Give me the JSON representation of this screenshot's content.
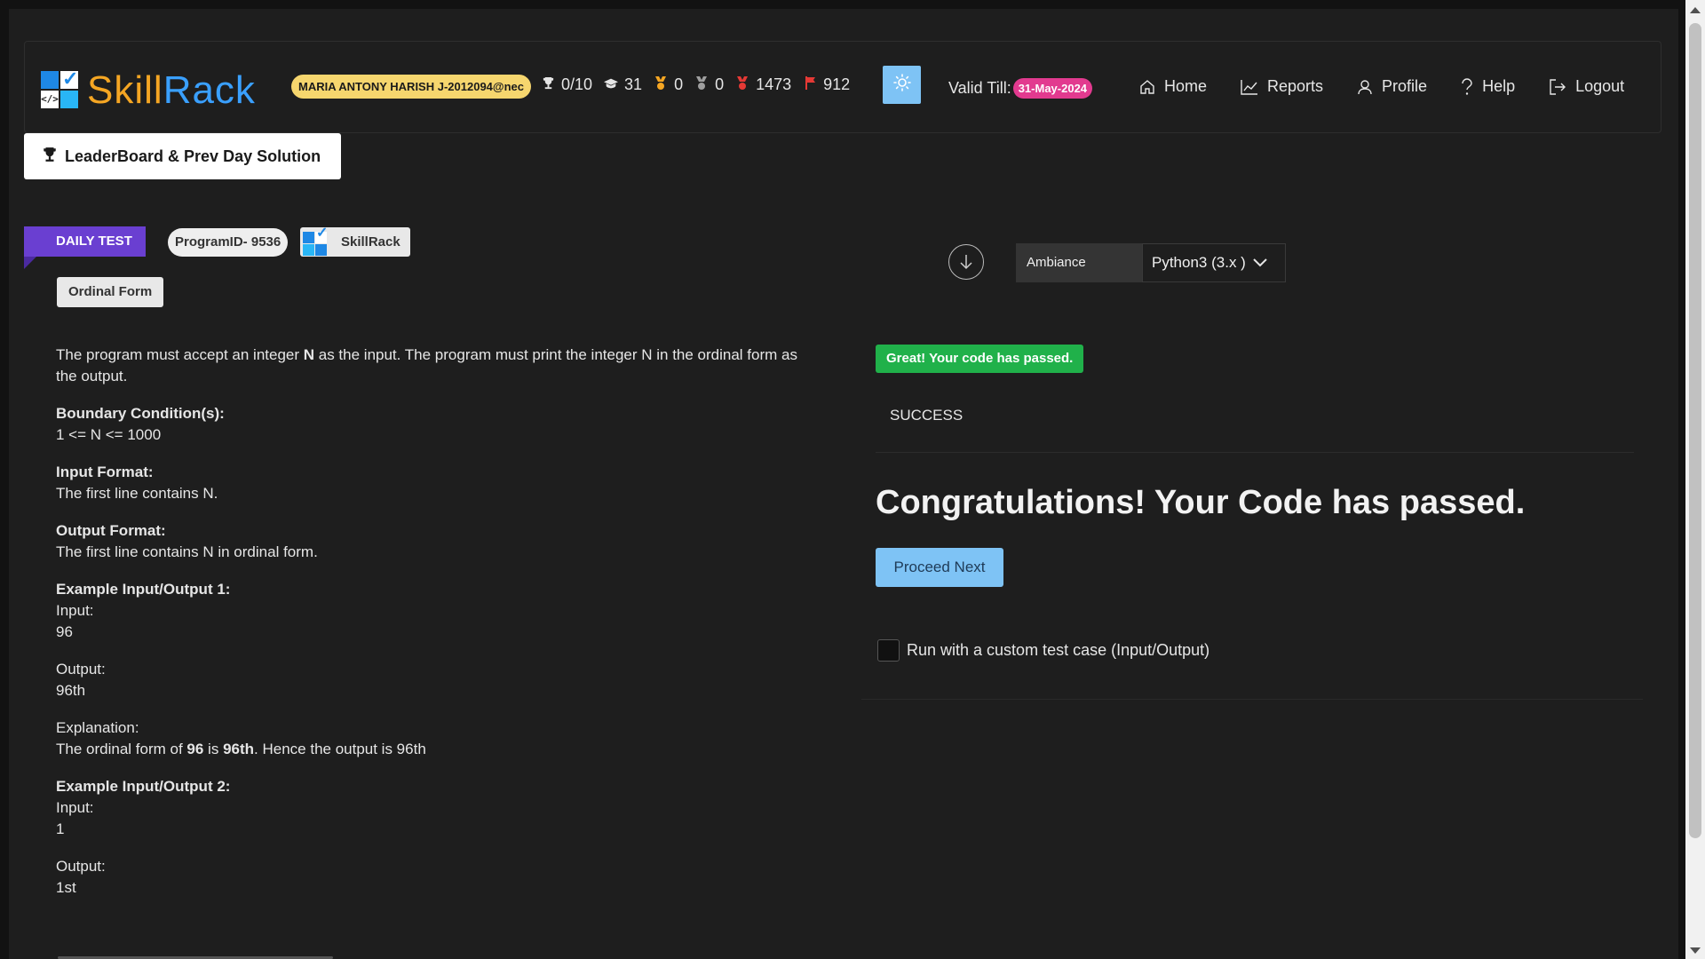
{
  "header": {
    "logo_prefix": "Skill",
    "logo_suffix": "Rack",
    "logo_code_glyph": "</>",
    "user_badge": "MARIA ANTONY HARISH J-2012094@nec",
    "stats": [
      {
        "icon": "trophy-icon",
        "value": "0/10",
        "color": "#e6e6e6"
      },
      {
        "icon": "graduation-cap-icon",
        "value": "31",
        "color": "#e6e6e6"
      },
      {
        "icon": "gold-medal-icon",
        "value": "0",
        "color": "#f5a623"
      },
      {
        "icon": "silver-medal-icon",
        "value": "0",
        "color": "#9e9e9e"
      },
      {
        "icon": "red-medal-icon",
        "value": "1473",
        "color": "#e53935"
      },
      {
        "icon": "flag-icon",
        "value": "912",
        "color": "#e53935"
      }
    ],
    "valid_label": "Valid Till:",
    "valid_date": "31-May-2024",
    "nav": {
      "home": "Home",
      "reports": "Reports",
      "profile": "Profile",
      "help": "Help",
      "logout": "Logout"
    }
  },
  "leaderboard_button": "LeaderBoard & Prev Day Solution",
  "problem_header": {
    "daily_tag": "DAILY TEST",
    "program_id": "ProgramID- 9536",
    "brand_tag": "SkillRack",
    "title": "Ordinal Form"
  },
  "problem": {
    "intro_1": "The program must accept an integer ",
    "intro_bold": "N",
    "intro_2": " as the input. The program must print the integer N in the ordinal form as the output.",
    "boundary_heading": "Boundary Condition(s):",
    "boundary_text": "1 <= N <= 1000",
    "input_heading": "Input Format:",
    "input_text": "The first line contains N.",
    "output_heading": "Output Format:",
    "output_text": "The first line contains N in ordinal form.",
    "ex1_heading": "Example Input/Output 1:",
    "ex1_input_label": "Input:",
    "ex1_input": "96",
    "ex1_output_label": "Output:",
    "ex1_output": "96th",
    "explanation_label": "Explanation:",
    "explanation_1": "The ordinal form of ",
    "explanation_b1": "96",
    "explanation_2": " is ",
    "explanation_b2": "96th",
    "explanation_3": ". Hence the output is 96th",
    "ex2_heading": "Example Input/Output 2:",
    "ex2_input_label": "Input:",
    "ex2_input": "1",
    "ex2_output_label": "Output:",
    "ex2_output": "1st"
  },
  "editor": {
    "ambiance_label": "Ambiance",
    "language": "Python3 (3.x )"
  },
  "result": {
    "pass_badge": "Great! Your code has passed.",
    "status": "SUCCESS",
    "congrats": "Congratulations! Your Code has passed.",
    "proceed_button": "Proceed Next",
    "custom_test_label": "Run with a custom test case (Input/Output)"
  },
  "colors": {
    "accent_blue": "#7ec3f5",
    "daily_purple": "#6a3fd1",
    "success_green": "#20b14a",
    "date_pink": "#e23a8f",
    "badge_yellow": "#f6d66e"
  }
}
